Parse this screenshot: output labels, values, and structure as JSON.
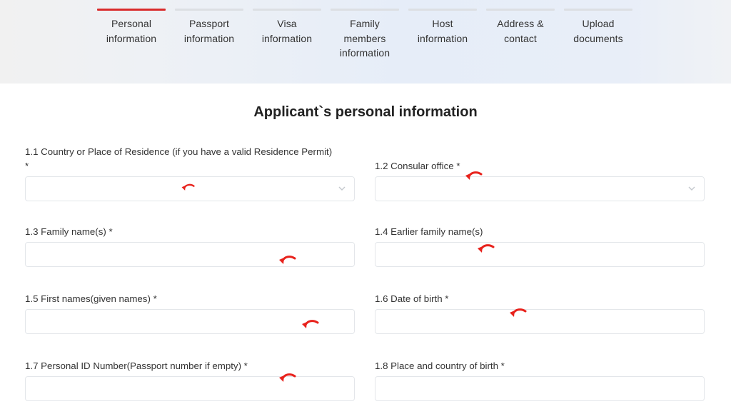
{
  "tabs": [
    {
      "label": "Personal\ninformation",
      "active": true
    },
    {
      "label": "Passport\ninformation",
      "active": false
    },
    {
      "label": "Visa\ninformation",
      "active": false
    },
    {
      "label": "Family\nmembers\ninformation",
      "active": false
    },
    {
      "label": "Host\ninformation",
      "active": false
    },
    {
      "label": "Address &\ncontact",
      "active": false
    },
    {
      "label": "Upload\ndocuments",
      "active": false
    }
  ],
  "form": {
    "title": "Applicant`s personal information",
    "fields": {
      "f11": {
        "label": "1.1 Country or Place of Residence (if you have a valid Residence Permit)",
        "required": "*",
        "value": ""
      },
      "f12": {
        "label": "1.2 Consular office *",
        "value": ""
      },
      "f13": {
        "label": "1.3 Family name(s) *",
        "value": ""
      },
      "f14": {
        "label": "1.4 Earlier family name(s)",
        "value": ""
      },
      "f15": {
        "label": "1.5 First names(given names) *",
        "value": ""
      },
      "f16": {
        "label": "1.6 Date of birth *",
        "value": ""
      },
      "f17": {
        "label": "1.7 Personal ID Number(Passport number if empty) *",
        "value": ""
      },
      "f18": {
        "label": "1.8 Place and country of birth *",
        "value": ""
      }
    }
  },
  "colors": {
    "accent": "#d92b2b",
    "annotation": "#e8221c"
  },
  "icons": {
    "select": "chevron-down-icon",
    "annotation": "curved-arrow-icon"
  }
}
